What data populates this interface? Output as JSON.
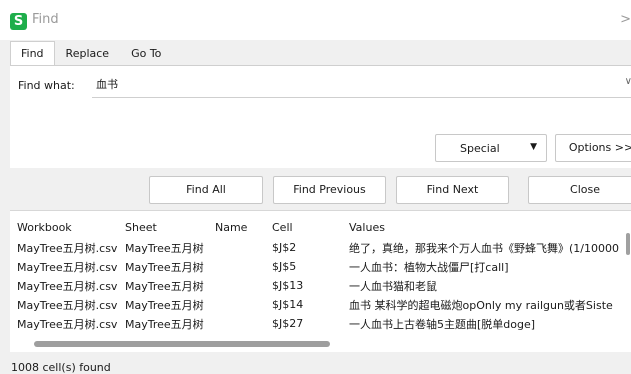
{
  "window": {
    "title": "Find",
    "app_icon_letter": "S",
    "close_glyph": ">"
  },
  "tabs": [
    {
      "label": "Find",
      "active": true
    },
    {
      "label": "Replace",
      "active": false
    },
    {
      "label": "Go To",
      "active": false
    }
  ],
  "find": {
    "label": "Find what:",
    "value": "血书",
    "dropdown_glyph": "∨"
  },
  "buttons": {
    "special": "Special",
    "special_caret": "▼",
    "options": "Options >>",
    "find_all": "Find All",
    "find_previous": "Find Previous",
    "find_next": "Find Next",
    "close": "Close"
  },
  "results": {
    "columns": [
      "Workbook",
      "Sheet",
      "Name",
      "Cell",
      "Values"
    ],
    "rows": [
      [
        "MayTree五月树.csv",
        "MayTree五月树",
        "",
        "$J$2",
        "绝了，真绝，那我来个万人血书《野蜂飞舞》(1/10000"
      ],
      [
        "MayTree五月树.csv",
        "MayTree五月树",
        "",
        "$J$5",
        "一人血书：植物大战僵尸[打call]"
      ],
      [
        "MayTree五月树.csv",
        "MayTree五月树",
        "",
        "$J$13",
        "一人血书猫和老鼠"
      ],
      [
        "MayTree五月树.csv",
        "MayTree五月树",
        "",
        "$J$14",
        "血书 某科学的超电磁炮opOnly my railgun或者Siste"
      ],
      [
        "MayTree五月树.csv",
        "MayTree五月树",
        "",
        "$J$27",
        "一人血书上古卷轴5主题曲[脱单doge]"
      ]
    ]
  },
  "status": "1008 cell(s) found",
  "colors": {
    "accent_green": "#1fae4b"
  },
  "icons": {
    "app": "spreadsheet-app-icon",
    "dropdown": "chevron-down-icon"
  }
}
